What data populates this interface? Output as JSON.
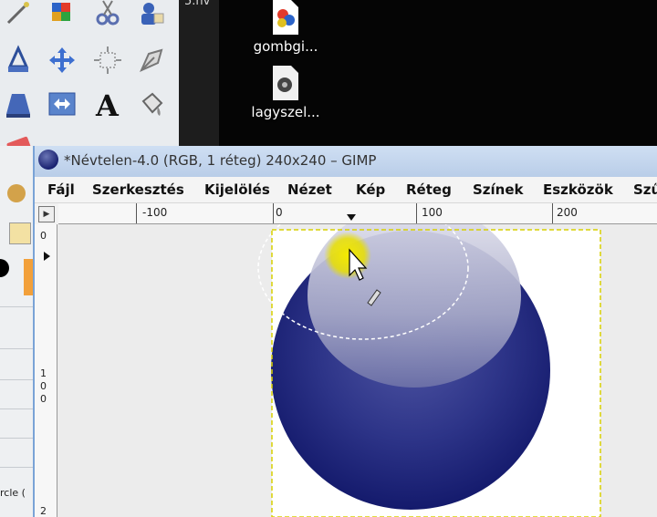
{
  "toolbox": {
    "tools": [
      {
        "name": "airbrush-tool",
        "icon": "airbrush-icon"
      },
      {
        "name": "color-picker-tool",
        "icon": "color-picker-icon"
      },
      {
        "name": "scissors-select-tool",
        "icon": "scissors-icon"
      },
      {
        "name": "foreground-select-tool",
        "icon": "foreground-select-icon"
      },
      {
        "name": "clone-tool",
        "icon": "clone-stamp-icon"
      },
      {
        "name": "move-tool",
        "icon": "move-arrows-icon"
      },
      {
        "name": "crop-tool",
        "icon": "crop-icon"
      },
      {
        "name": "paths-tool",
        "icon": "paths-pen-icon"
      },
      {
        "name": "perspective-tool",
        "icon": "perspective-icon"
      },
      {
        "name": "flip-tool",
        "icon": "flip-icon"
      },
      {
        "name": "text-tool",
        "icon": "text-a-icon"
      },
      {
        "name": "bucket-fill-tool",
        "icon": "bucket-fill-icon"
      }
    ],
    "partial_label": "rcle ("
  },
  "desktop": {
    "strip_text": "5.nv",
    "icons": [
      {
        "label": "gombgi...",
        "icon": "image-file-icon"
      },
      {
        "label": "lagyszel...",
        "icon": "document-file-icon"
      }
    ]
  },
  "window": {
    "title": "*Névtelen-4.0 (RGB, 1 réteg) 240x240 – GIMP",
    "menu": [
      "Fájl",
      "Szerkesztés",
      "Kijelölés",
      "Nézet",
      "Kép",
      "Réteg",
      "Színek",
      "Eszközök",
      "Szű"
    ],
    "hruler_labels": [
      "-100",
      "0",
      "100",
      "200"
    ],
    "vruler_labels": [
      "0",
      "1",
      "0",
      "0",
      "2"
    ]
  },
  "colors": {
    "sphere_dark": "#141a6e",
    "sphere_mid": "#33398a",
    "highlight": "#c3c5da",
    "cursor_glow": "#e8df00",
    "titlebar": "#c3d5ee"
  }
}
